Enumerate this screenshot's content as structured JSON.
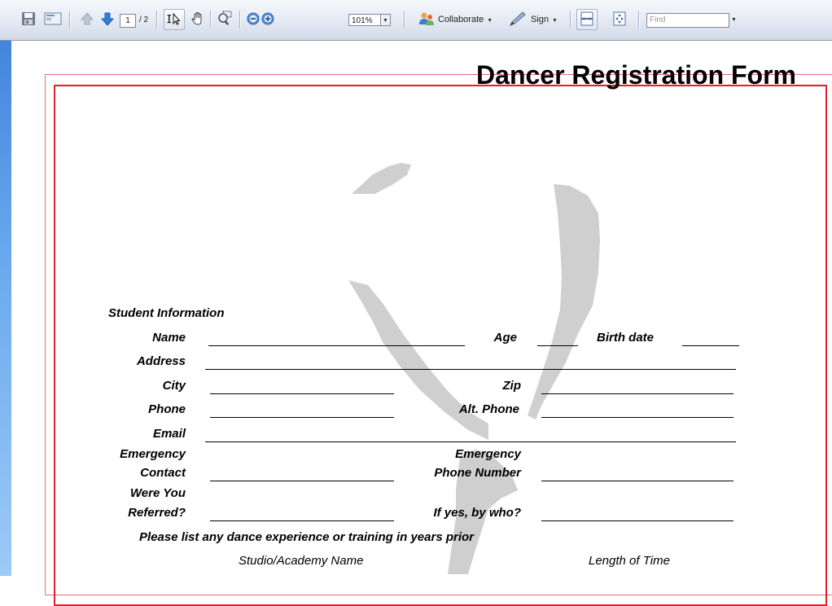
{
  "toolbar": {
    "current_page": "1",
    "total_pages": "/ 2",
    "zoom": "101%",
    "collaborate_label": "Collaborate",
    "sign_label": "Sign",
    "find_placeholder": "Find",
    "icons": [
      "save-icon",
      "email-icon",
      "previous-page-icon",
      "next-page-icon",
      "select-tool-icon",
      "hand-tool-icon",
      "marquee-zoom-icon",
      "zoom-out-icon",
      "zoom-in-icon",
      "collaborate-icon",
      "sign-icon",
      "fit-width-icon",
      "fit-page-icon"
    ]
  },
  "form": {
    "title": "Dancer Registration Form",
    "section_student": "Student Information",
    "labels": {
      "name": "Name",
      "age": "Age",
      "birth_date": "Birth date",
      "address": "Address",
      "city": "City",
      "zip": "Zip",
      "phone": "Phone",
      "alt_phone": "Alt. Phone",
      "email": "Email",
      "emergency_contact_1": "Emergency",
      "emergency_contact_2": "Contact",
      "emergency_phone_1": "Emergency",
      "emergency_phone_2": "Phone Number",
      "referred_1": "Were You",
      "referred_2": "Referred?",
      "referred_by": "If yes, by who?",
      "experience_prompt": "Please list any dance experience or training in years prior",
      "studio_col": "Studio/Academy Name",
      "length_col": "Length of Time"
    }
  },
  "colors": {
    "border_red": "#e0202d",
    "watermark": "#cfcfcf",
    "left_strip": "#4a8ee0"
  }
}
